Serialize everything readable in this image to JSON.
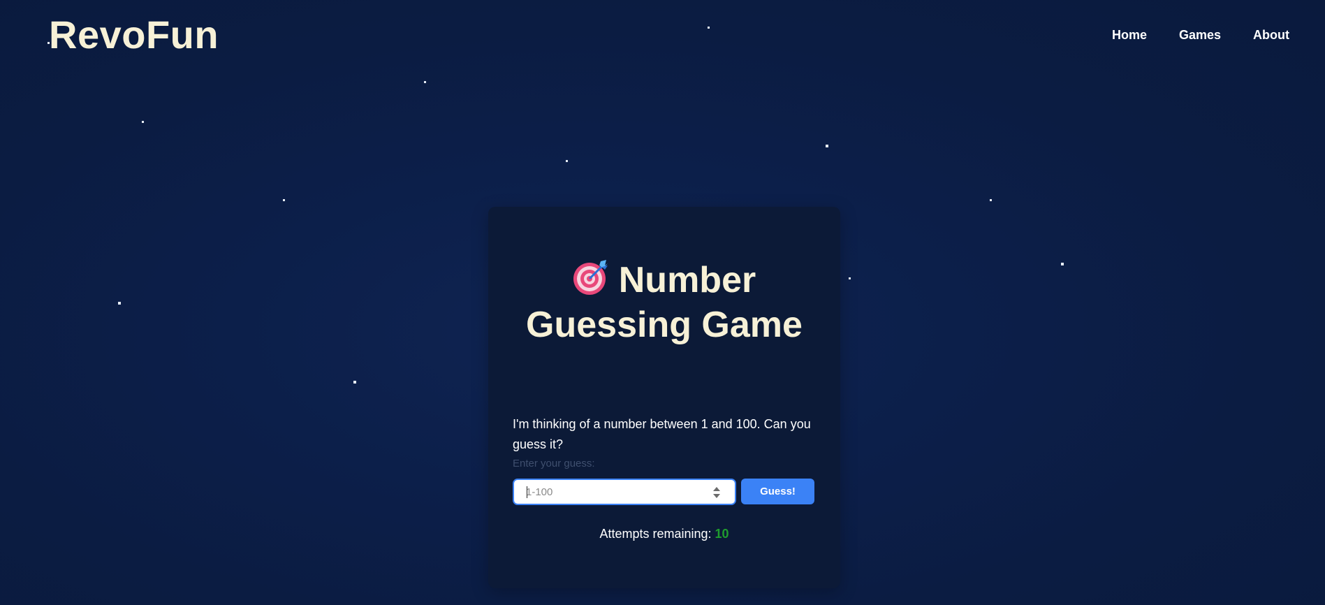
{
  "header": {
    "logo": "RevoFun",
    "nav": [
      {
        "label": "Home"
      },
      {
        "label": "Games"
      },
      {
        "label": "About"
      }
    ]
  },
  "game": {
    "icon": "target-dart-icon",
    "title": "Number Guessing Game",
    "description": "I'm thinking of a number between 1 and 100. Can you guess it?",
    "input_label": "Enter your guess:",
    "input_placeholder": "1-100",
    "input_value": "",
    "button_label": "Guess!",
    "attempts_label": "Attempts remaining:",
    "attempts_value": "10"
  },
  "colors": {
    "background": "#0b1c42",
    "card": "#0c1a37",
    "accent": "#3b82f6",
    "title": "#f7f1d7",
    "attempts": "#1f9d2e"
  }
}
